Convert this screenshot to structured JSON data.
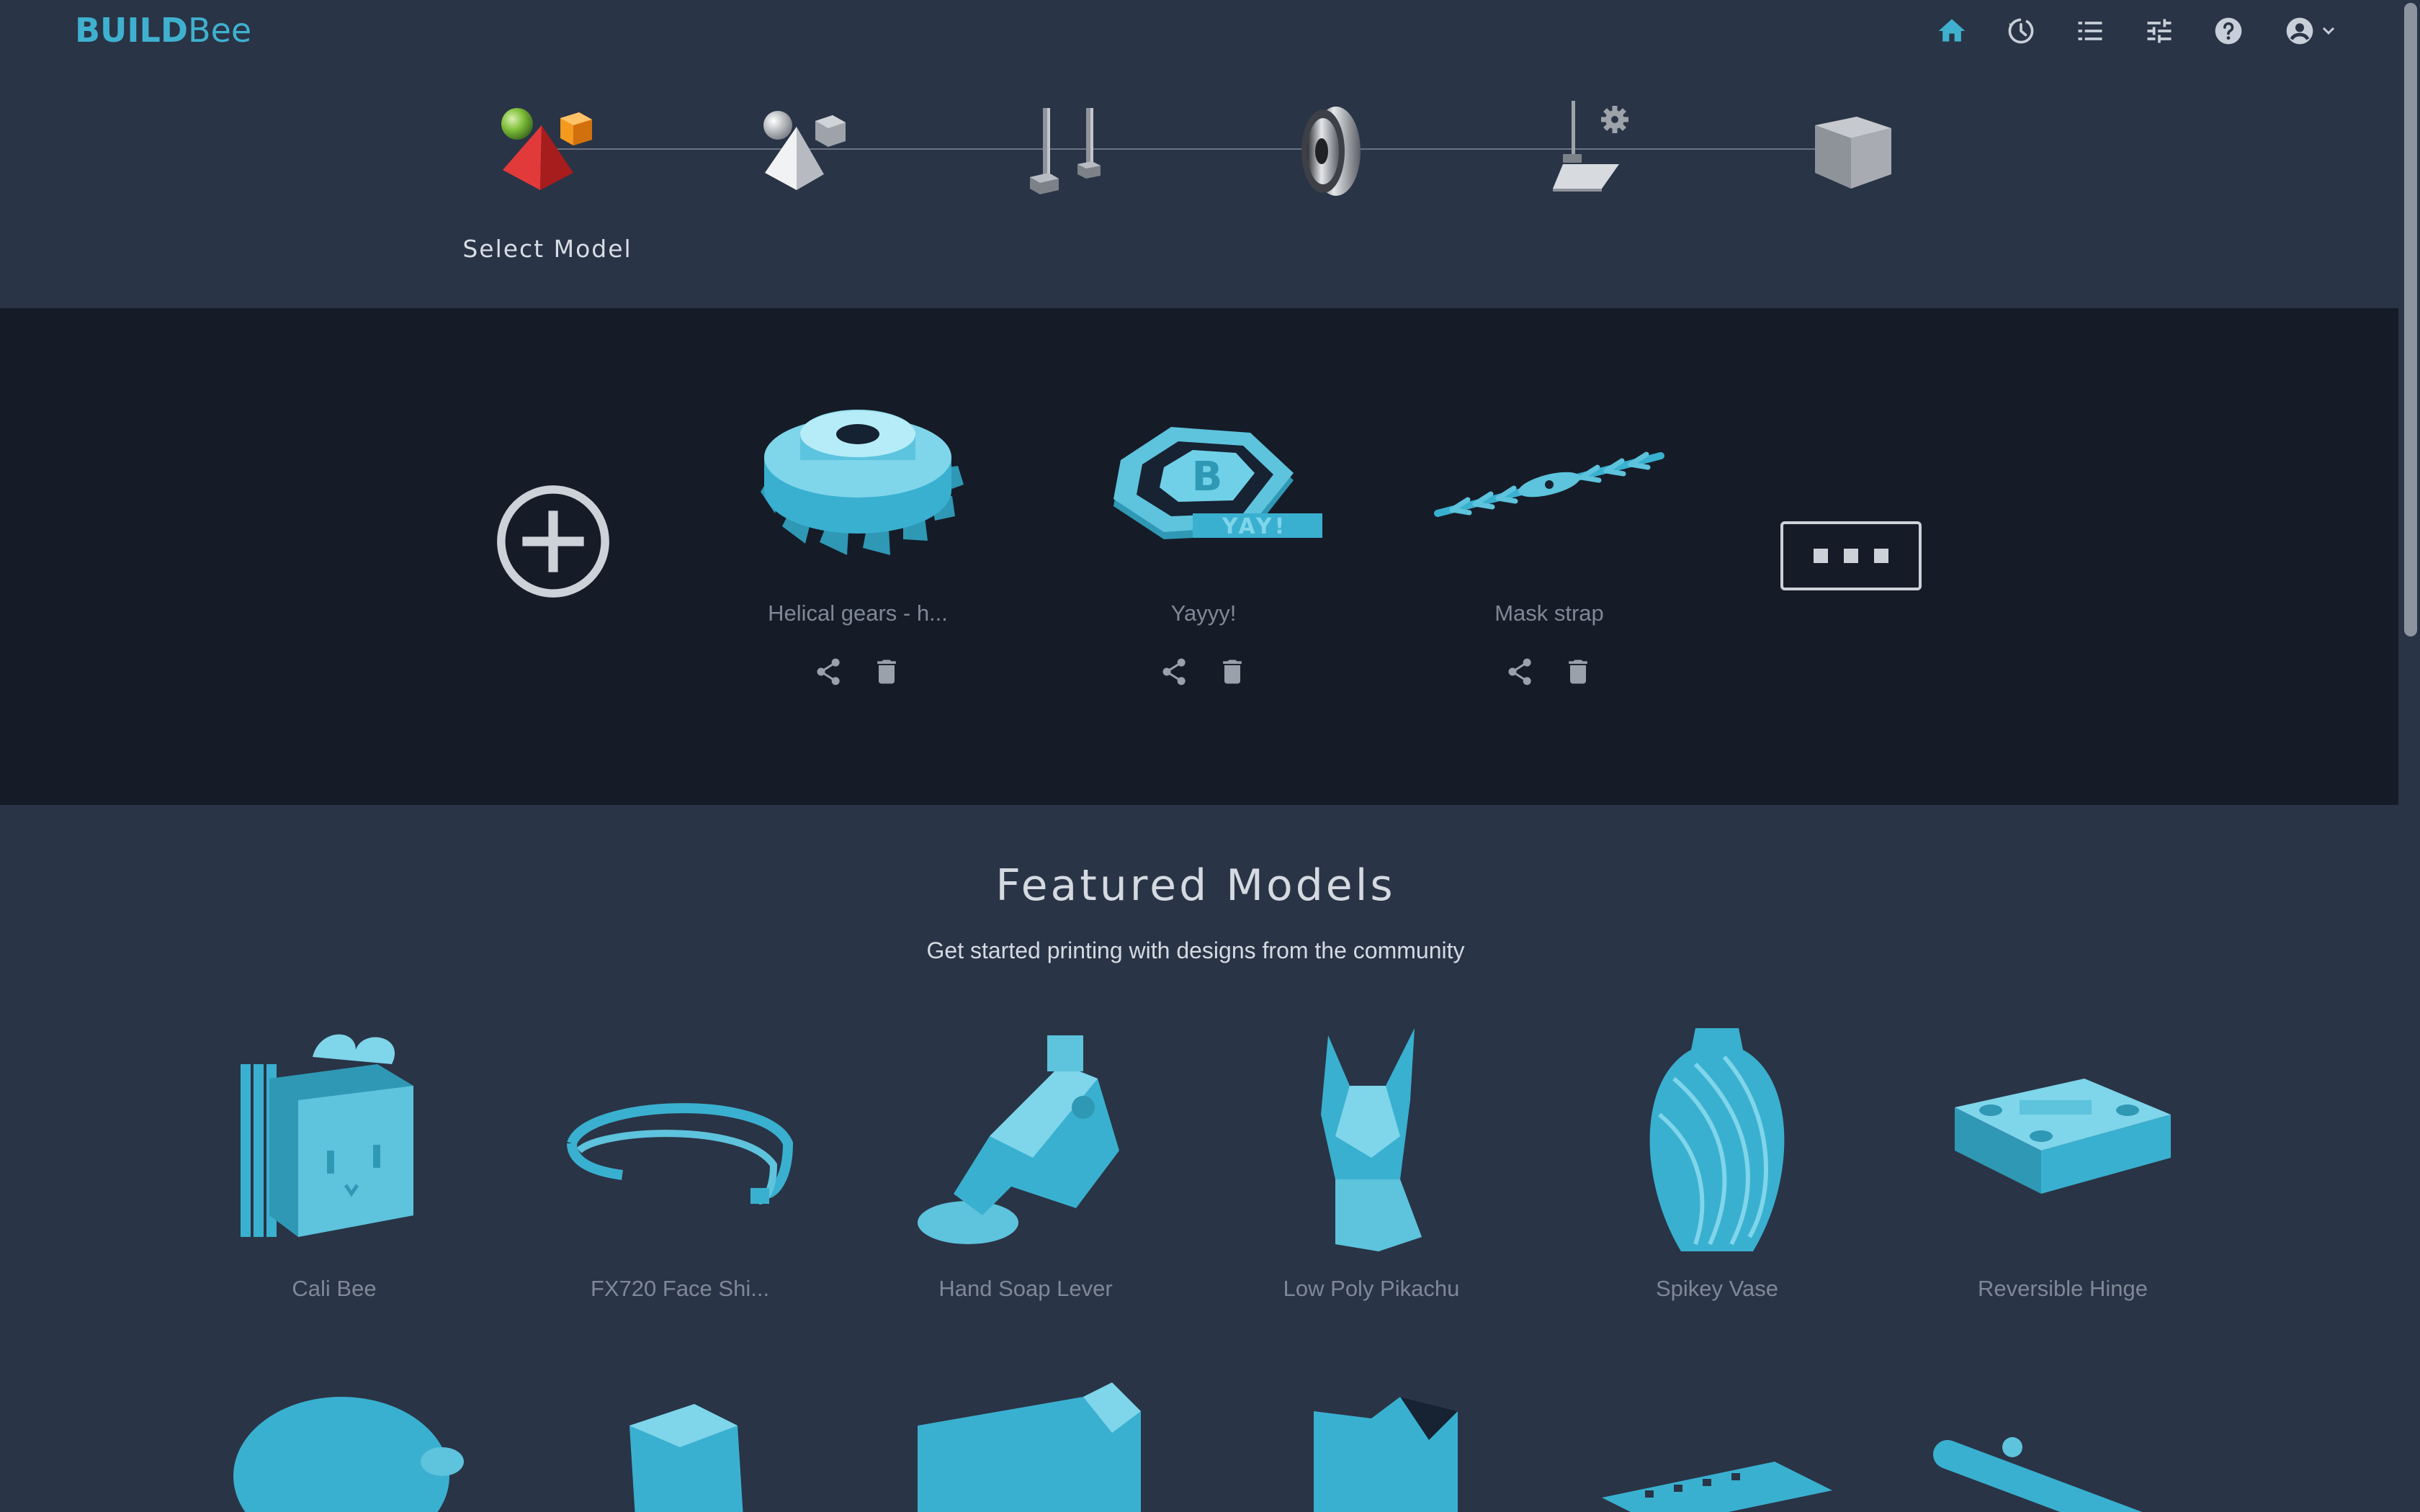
{
  "brand": {
    "logo_text_bold": "BUILD",
    "logo_text_light": "Bee",
    "accent_color": "#3fb1cf"
  },
  "nav": {
    "icons": [
      "home-icon",
      "history-icon",
      "list-icon",
      "settings-sliders-icon",
      "help-icon",
      "account-icon"
    ],
    "active": "home-icon"
  },
  "wizard": {
    "steps": [
      "select-model-step",
      "slice-model-step",
      "supports-step",
      "filament-step",
      "printer-settings-step",
      "print-step"
    ],
    "active_label": "Select Model"
  },
  "recent": {
    "items": [
      {
        "name": "Helical gears - h..."
      },
      {
        "name": "Yayyy!"
      },
      {
        "name": "Mask strap"
      }
    ]
  },
  "featured": {
    "title": "Featured Models",
    "subtitle": "Get started printing with designs from the community",
    "items": [
      {
        "name": "Cali Bee"
      },
      {
        "name": "FX720 Face Shi..."
      },
      {
        "name": "Hand Soap Lever"
      },
      {
        "name": "Low Poly Pikachu"
      },
      {
        "name": "Spikey Vase"
      },
      {
        "name": "Reversible Hinge"
      }
    ]
  },
  "colors": {
    "page_bg": "#293446",
    "recent_bg": "#151c27",
    "model_color": "#5ec3dd"
  }
}
